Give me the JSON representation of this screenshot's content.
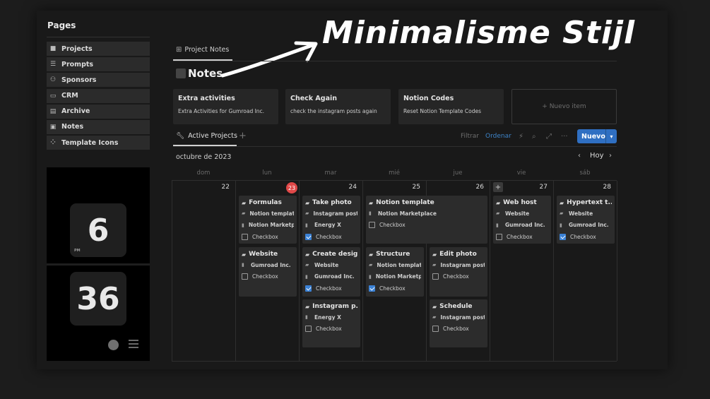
{
  "sidebar": {
    "title": "Pages",
    "items": [
      {
        "label": "Projects",
        "icon": "folder-icon"
      },
      {
        "label": "Prompts",
        "icon": "list-icon"
      },
      {
        "label": "Sponsors",
        "icon": "people-icon"
      },
      {
        "label": "CRM",
        "icon": "card-icon"
      },
      {
        "label": "Archive",
        "icon": "archive-icon"
      },
      {
        "label": "Notes",
        "icon": "note-icon"
      },
      {
        "label": "Template Icons",
        "icon": "shapes-icon"
      }
    ]
  },
  "clock": {
    "hour": "6",
    "minute": "36",
    "ampm": "PM"
  },
  "annotation": "Minimalisme Stijl",
  "header": {
    "tab": "Project Notes",
    "title": "Notes"
  },
  "gallery": [
    {
      "title": "Extra activities",
      "subtitle": "Extra Activities for Gumroad Inc."
    },
    {
      "title": "Check Again",
      "subtitle": "check the instagram posts again"
    },
    {
      "title": "Notion Codes",
      "subtitle": "Reset Notion Template Codes"
    }
  ],
  "gallery_new": "+ Nuevo item",
  "view": {
    "tab": "Active Projects",
    "add": "+"
  },
  "toolbar": {
    "filter": "Filtrar",
    "sort": "Ordenar",
    "new": "Nuevo"
  },
  "calendar": {
    "month": "octubre de 2023",
    "today_label": "Hoy",
    "weekdays": [
      "dom",
      "lun",
      "mar",
      "mié",
      "jue",
      "vie",
      "sáb"
    ],
    "days": [
      "22",
      "23",
      "24",
      "25",
      "26",
      "27",
      "28"
    ],
    "events": {
      "formulas": {
        "title": "Formulas",
        "r1": "Notion template",
        "r2": "Notion Marketpla",
        "cb": "Checkbox",
        "checked": false
      },
      "website": {
        "title": "Website",
        "r1": "Gumroad Inc.",
        "cb": "Checkbox",
        "checked": false
      },
      "take_photo": {
        "title": "Take photo",
        "r1": "Instagram post",
        "r2": "Energy X",
        "cb": "Checkbox",
        "checked": true
      },
      "create_design": {
        "title": "Create design",
        "r1": "Website",
        "r2": "Gumroad Inc.",
        "cb": "Checkbox",
        "checked": true
      },
      "instagram_p": {
        "title": "Instagram p...",
        "r1": "Energy X",
        "cb": "Checkbox",
        "checked": false
      },
      "notion_template": {
        "title": "Notion template",
        "r1": "Notion Marketplace",
        "cb": "Checkbox",
        "checked": false
      },
      "structure": {
        "title": "Structure",
        "r1": "Notion template",
        "r2": "Notion Marketpl",
        "cb": "Checkbox",
        "checked": true
      },
      "edit_photo": {
        "title": "Edit photo",
        "r1": "Instagram post",
        "cb": "Checkbox",
        "checked": false
      },
      "schedule": {
        "title": "Schedule",
        "r1": "Instagram post",
        "cb": "Checkbox",
        "checked": false
      },
      "web_host": {
        "title": "Web host",
        "r1": "Website",
        "r2": "Gumroad Inc.",
        "cb": "Checkbox",
        "checked": false
      },
      "hypertext": {
        "title": "Hypertext t...",
        "r1": "Website",
        "r2": "Gumroad Inc.",
        "cb": "Checkbox",
        "checked": true
      }
    }
  },
  "colors": {
    "accent": "#2f6fc2",
    "today": "#e04848",
    "checkbox": "#3b82d6"
  }
}
